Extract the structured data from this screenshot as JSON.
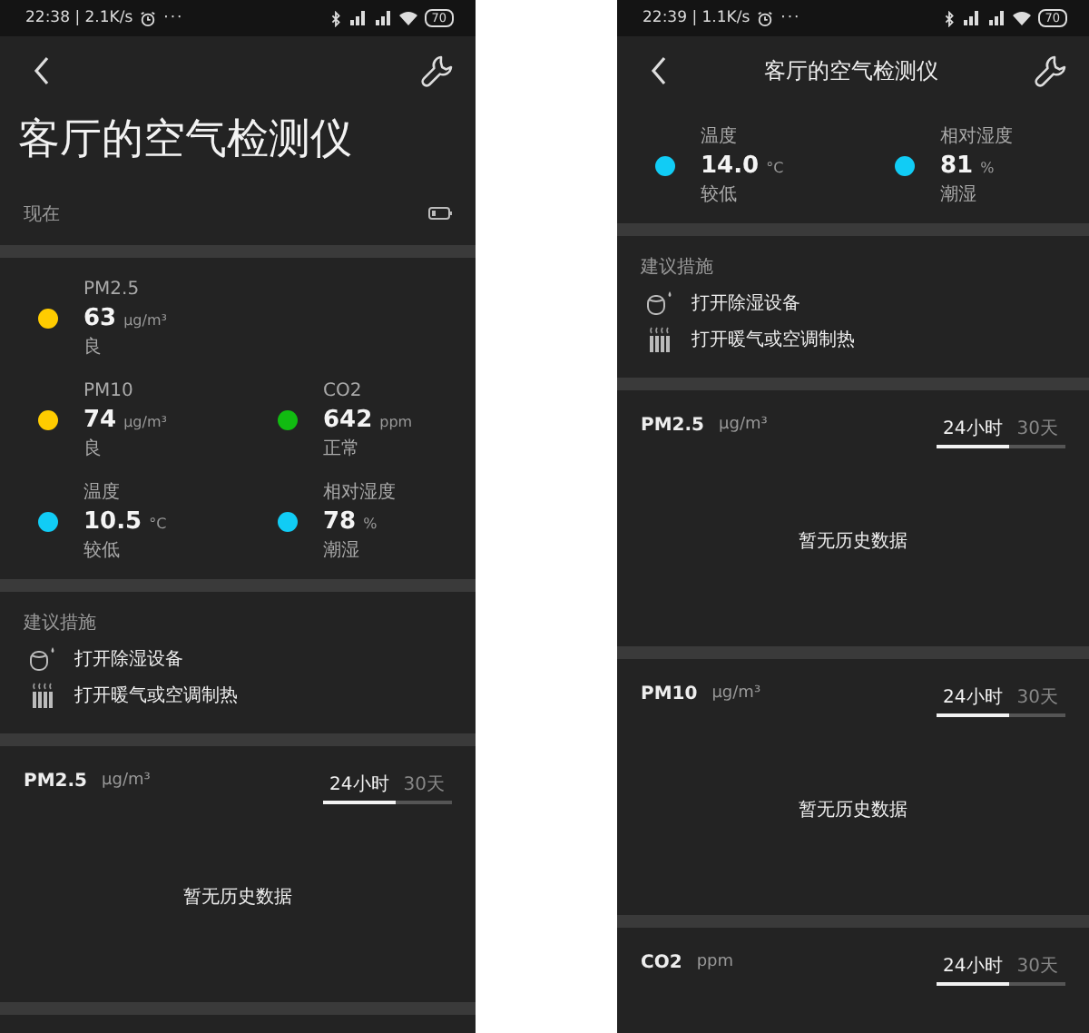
{
  "phones": [
    {
      "status_bar": {
        "time": "22:38 | 2.1K/s",
        "more": "···",
        "battery": "70"
      },
      "trailing_divider": true,
      "title": {
        "kind": "large",
        "text": "客厅的空气检测仪"
      },
      "subtitle": "现在",
      "metric_rows": [
        [
          {
            "name": "PM2.5",
            "value": "63",
            "unit": "μg/m³",
            "status": "良",
            "color": "#ffcc00"
          }
        ],
        [
          {
            "name": "PM10",
            "value": "74",
            "unit": "μg/m³",
            "status": "良",
            "color": "#ffcc00"
          },
          {
            "name": "CO2",
            "value": "642",
            "unit": "ppm",
            "status": "正常",
            "color": "#11bb11"
          }
        ],
        [
          {
            "name": "温度",
            "value": "10.5",
            "unit": "°C",
            "status": "较低",
            "color": "#11ccf5"
          },
          {
            "name": "相对湿度",
            "value": "78",
            "unit": "%",
            "status": "潮湿",
            "color": "#11ccf5"
          }
        ]
      ],
      "suggestions": {
        "heading": "建议措施",
        "items": [
          {
            "kind": "dehumidifier",
            "text": "打开除湿设备"
          },
          {
            "kind": "heater",
            "text": "打开暖气或空调制热"
          }
        ]
      },
      "charts": [
        {
          "name": "PM2.5",
          "unit": "μg/m³",
          "tabs": [
            {
              "label": "24小时",
              "selected": true
            },
            {
              "label": "30天",
              "selected": false
            }
          ],
          "empty_text": "暂无历史数据"
        }
      ]
    },
    {
      "status_bar": {
        "time": "22:39 | 1.1K/s",
        "more": "···",
        "battery": "70"
      },
      "title": {
        "kind": "compact",
        "text": "客厅的空气检测仪"
      },
      "metric_rows": [
        [
          {
            "name": "温度",
            "value": "14.0",
            "unit": "°C",
            "status": "较低",
            "color": "#11ccf5"
          },
          {
            "name": "相对湿度",
            "value": "81",
            "unit": "%",
            "status": "潮湿",
            "color": "#11ccf5"
          }
        ]
      ],
      "suggestions": {
        "heading": "建议措施",
        "items": [
          {
            "kind": "dehumidifier",
            "text": "打开除湿设备"
          },
          {
            "kind": "heater",
            "text": "打开暖气或空调制热"
          }
        ]
      },
      "charts": [
        {
          "name": "PM2.5",
          "unit": "μg/m³",
          "tabs": [
            {
              "label": "24小时",
              "selected": true
            },
            {
              "label": "30天",
              "selected": false
            }
          ],
          "empty_text": "暂无历史数据"
        },
        {
          "name": "PM10",
          "unit": "μg/m³",
          "tabs": [
            {
              "label": "24小时",
              "selected": true
            },
            {
              "label": "30天",
              "selected": false
            }
          ],
          "empty_text": "暂无历史数据"
        },
        {
          "name": "CO2",
          "unit": "ppm",
          "tabs": [
            {
              "label": "24小时",
              "selected": true
            },
            {
              "label": "30天",
              "selected": false
            }
          ]
        }
      ]
    }
  ]
}
